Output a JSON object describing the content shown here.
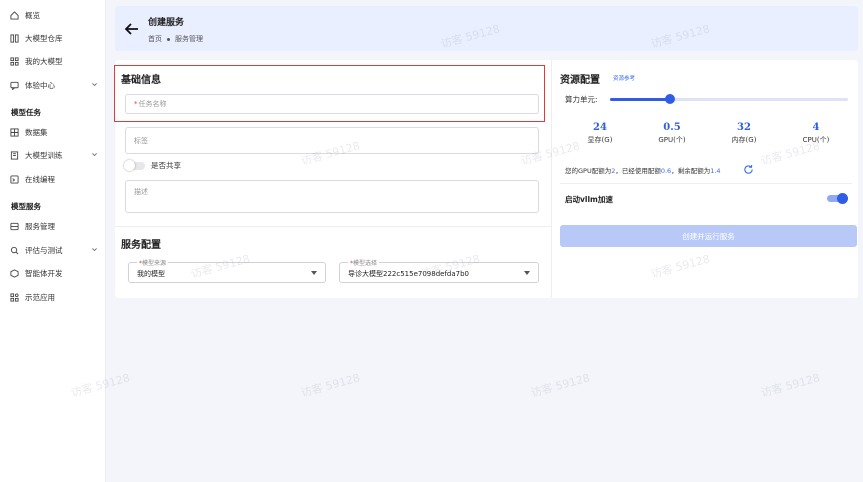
{
  "sidebar": {
    "items": [
      {
        "label": "概览",
        "icon": "home-icon"
      },
      {
        "label": "大模型仓库",
        "icon": "grid-icon"
      },
      {
        "label": "我的大模型",
        "icon": "apps-icon"
      },
      {
        "label": "体验中心",
        "icon": "chat-icon"
      },
      {
        "label": "数据集",
        "icon": "dataset-icon"
      },
      {
        "label": "大模型训练",
        "icon": "training-icon"
      },
      {
        "label": "在线编程",
        "icon": "code-icon"
      },
      {
        "label": "服务管理",
        "icon": "service-icon"
      },
      {
        "label": "评估与测试",
        "icon": "eval-icon"
      },
      {
        "label": "智能体开发",
        "icon": "agent-icon"
      },
      {
        "label": "示范应用",
        "icon": "demo-icon"
      }
    ],
    "sections": [
      "模型任务",
      "模型服务"
    ]
  },
  "header": {
    "title": "创建服务",
    "breadcrumb": [
      "首页",
      "服务管理"
    ]
  },
  "basic": {
    "title": "基础信息",
    "task_name_placeholder": "任务名称",
    "required_mark": "*",
    "tag_placeholder": "标签",
    "share_label": "是否共享",
    "desc_placeholder": "描述"
  },
  "service": {
    "title": "服务配置",
    "source_label": "模型来源",
    "source_value": "我的模型",
    "model_label": "模型选择",
    "model_value": "导诊大模型222c515e7098defda7b0"
  },
  "resource": {
    "title": "资源配置",
    "ref_link": "资源参考",
    "slider_label": "算力单元:",
    "slider_value": 0.25,
    "stats": [
      {
        "num": "24",
        "label": "显存(G)"
      },
      {
        "num": "0.5",
        "label": "GPU(个)"
      },
      {
        "num": "32",
        "label": "内存(G)"
      },
      {
        "num": "4",
        "label": "CPU(个)"
      }
    ],
    "quota_prefix": "您的GPU配额为",
    "quota_total": "2",
    "quota_used_prefix": "，已经使用配额",
    "quota_used": "0.6",
    "quota_left_prefix": "，剩余配额为",
    "quota_left": "1.4",
    "vllm_label": "启动vllm加速",
    "vllm_on": true,
    "create_button": "创建并运行服务"
  },
  "watermark": "访客 59128",
  "colors": {
    "accent": "#2f5de8",
    "highlight": "#e23b3b",
    "header_bg": "#e9efff"
  }
}
